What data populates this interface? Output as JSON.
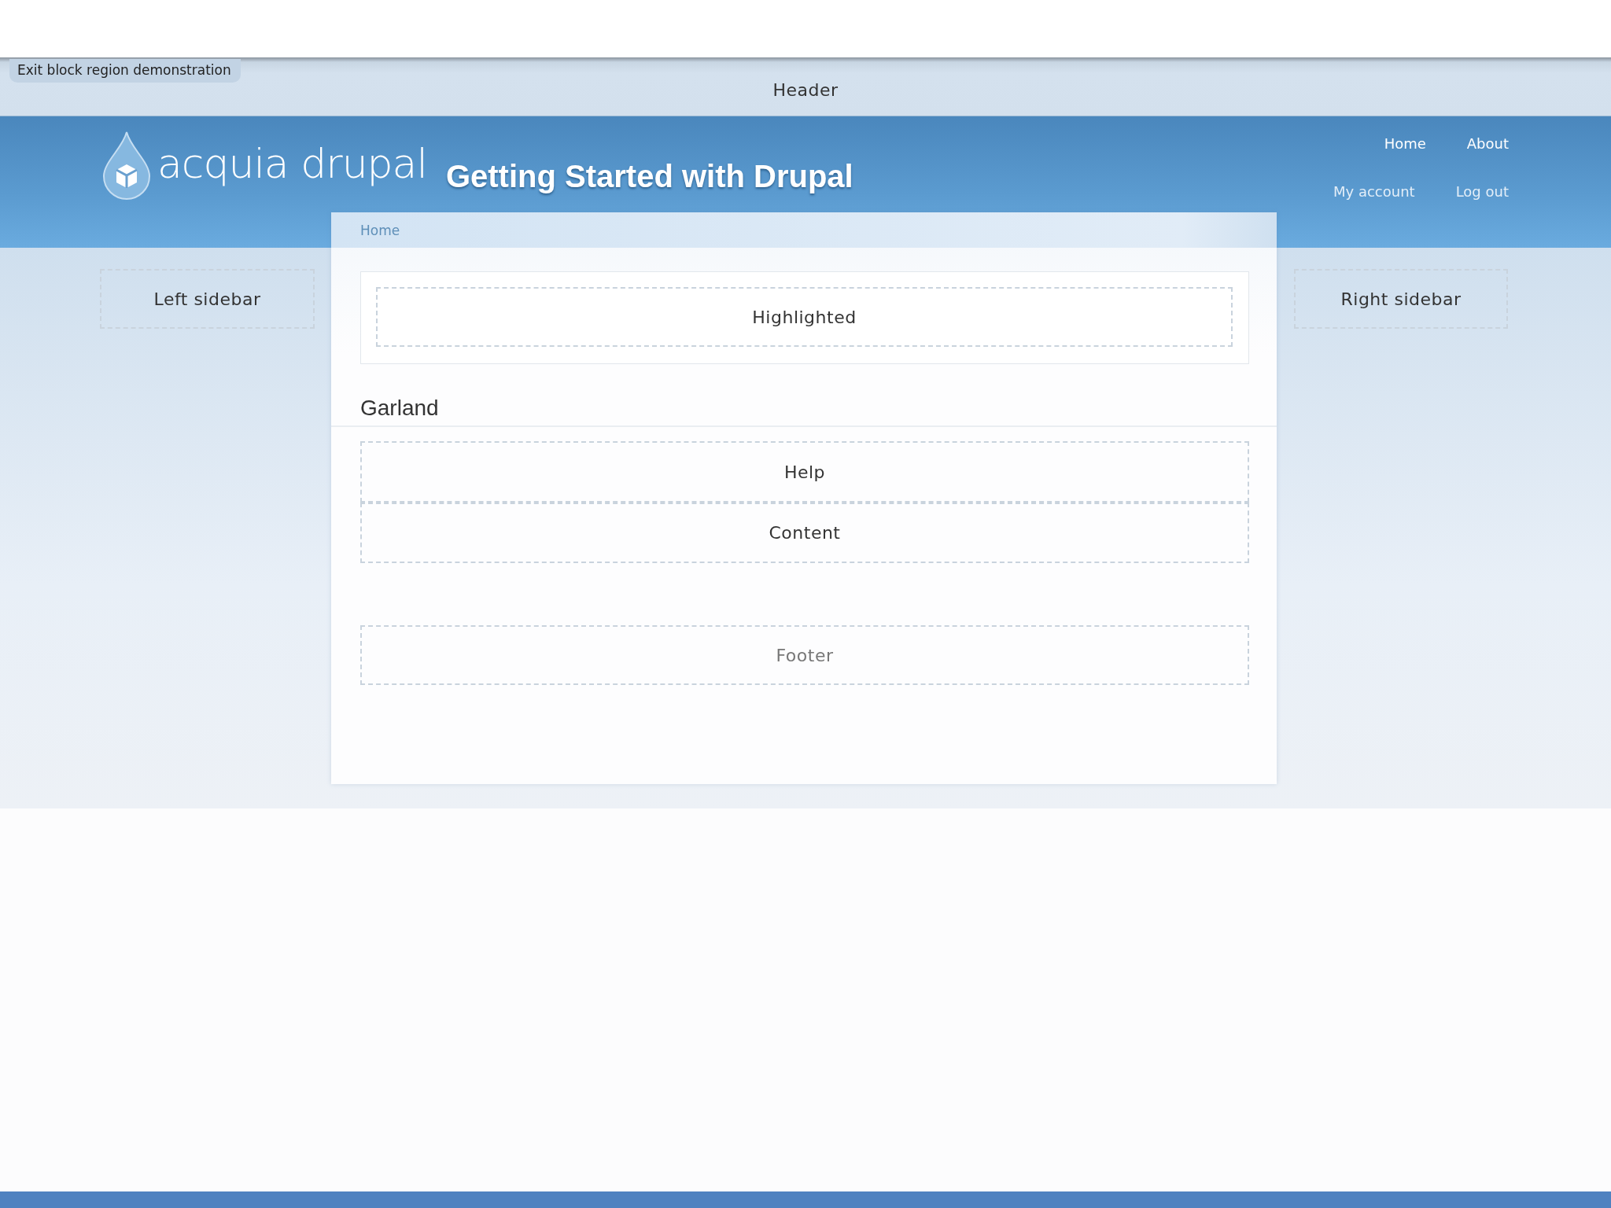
{
  "toolbar": {
    "exit_button": "Exit block region demonstration"
  },
  "header_region": "Header",
  "site": {
    "logo_text": "acquia drupal",
    "title": "Getting Started with Drupal"
  },
  "primary_links": [
    {
      "label": "Home"
    },
    {
      "label": "About"
    }
  ],
  "secondary_links": [
    {
      "label": "My account"
    },
    {
      "label": "Log out"
    }
  ],
  "breadcrumb": [
    "Home"
  ],
  "left_sidebar": "Left sidebar",
  "right_sidebar": "Right sidebar",
  "highlighted": "Highlighted",
  "page_title": "Garland",
  "help": "Help",
  "content": "Content",
  "footer": "Footer"
}
